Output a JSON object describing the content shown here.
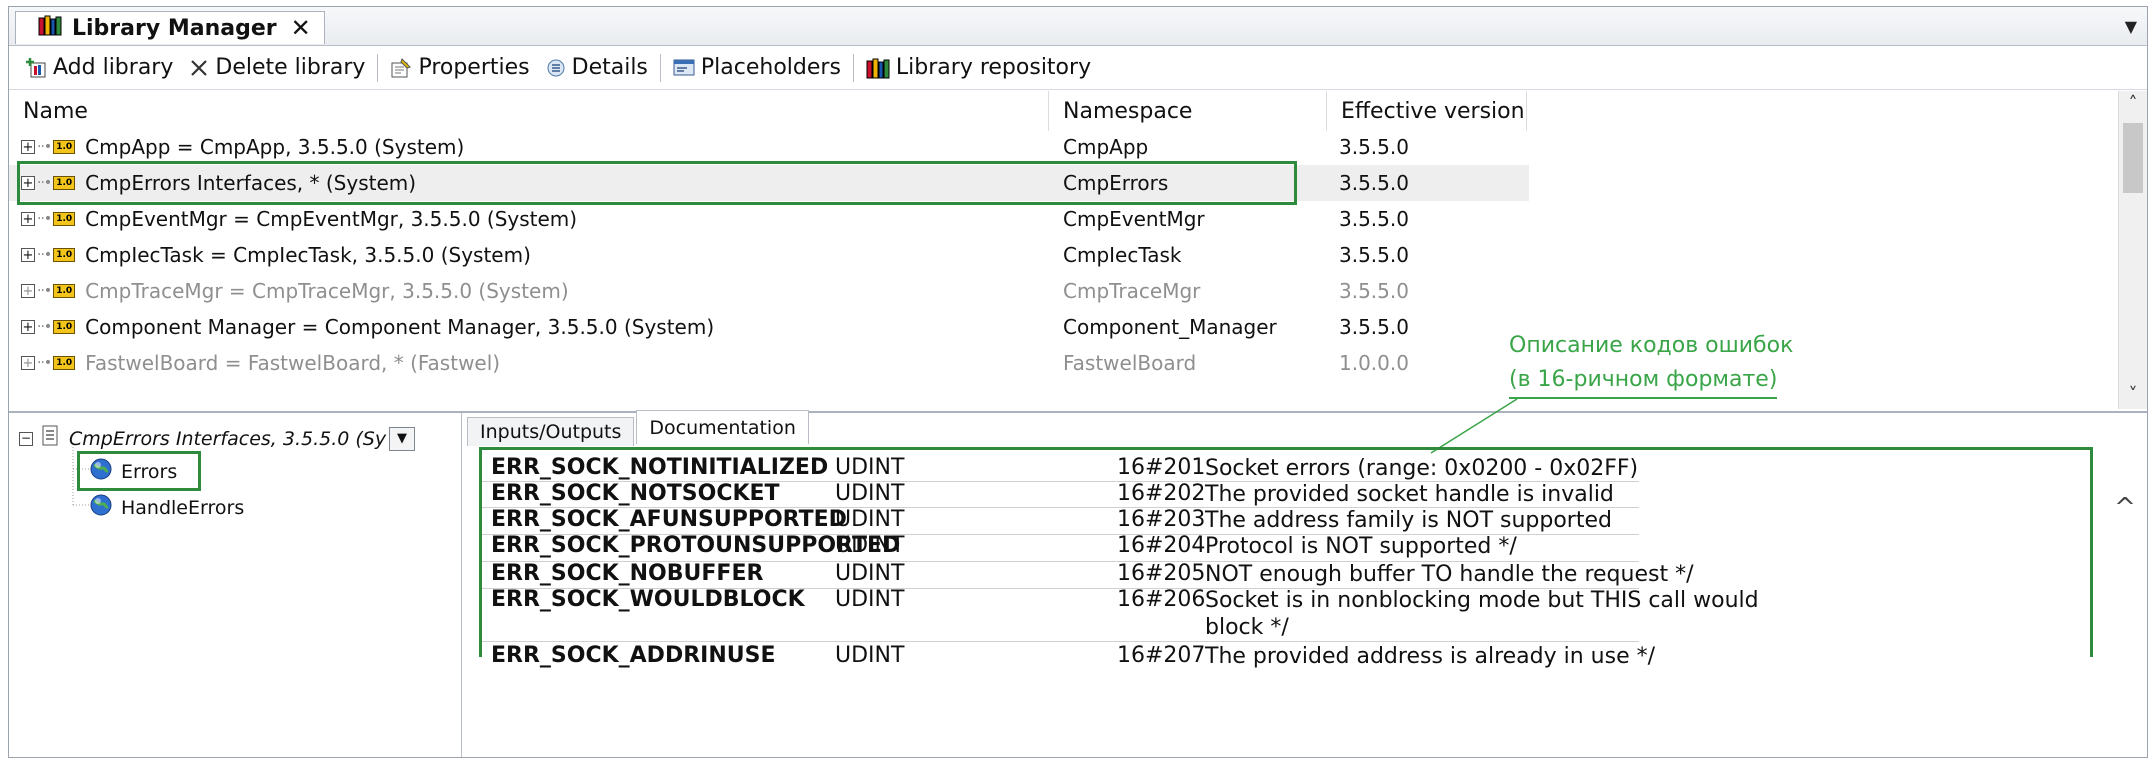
{
  "tab": {
    "title": "Library Manager",
    "close": "✕",
    "menu": "▼"
  },
  "toolbar": {
    "add_library": "Add library",
    "delete_library": "Delete library",
    "properties": "Properties",
    "details": "Details",
    "placeholders": "Placeholders",
    "library_repository": "Library repository"
  },
  "list": {
    "headers": {
      "name": "Name",
      "namespace": "Namespace",
      "version": "Effective version"
    },
    "rows": [
      {
        "name": "CmpApp = CmpApp, 3.5.5.0 (System)",
        "namespace": "CmpApp",
        "version": "3.5.5.0",
        "state": "normal"
      },
      {
        "name": "CmpErrors Interfaces, * (System)",
        "namespace": "CmpErrors",
        "version": "3.5.5.0",
        "state": "selected"
      },
      {
        "name": "CmpEventMgr = CmpEventMgr, 3.5.5.0 (System)",
        "namespace": "CmpEventMgr",
        "version": "3.5.5.0",
        "state": "normal"
      },
      {
        "name": "CmpIecTask = CmpIecTask, 3.5.5.0 (System)",
        "namespace": "CmpIecTask",
        "version": "3.5.5.0",
        "state": "normal"
      },
      {
        "name": "CmpTraceMgr = CmpTraceMgr, 3.5.5.0 (System)",
        "namespace": "CmpTraceMgr",
        "version": "3.5.5.0",
        "state": "disabled"
      },
      {
        "name": "Component Manager = Component Manager, 3.5.5.0 (System)",
        "namespace": "Component_Manager",
        "version": "3.5.5.0",
        "state": "normal"
      },
      {
        "name": "FastwelBoard = FastwelBoard, * (Fastwel)",
        "namespace": "FastwelBoard",
        "version": "1.0.0.0",
        "state": "disabled"
      }
    ],
    "badge": "1.0",
    "scroll_up": "˄",
    "scroll_down": "˅"
  },
  "annotation": {
    "line1": "Описание кодов ошибок",
    "line2": "(в 16-ричном формате)"
  },
  "tree": {
    "root": "CmpErrors Interfaces, 3.5.5.0 (Sy",
    "combo_arrow": "▼",
    "items": [
      "Errors",
      "HandleErrors"
    ]
  },
  "doc": {
    "tabs": [
      "Inputs/Outputs",
      "Documentation"
    ],
    "active_tab": "Documentation",
    "rows": [
      {
        "name": "ERR_SOCK_NOTINITIALIZED",
        "type": "UDINT",
        "value": "16#201",
        "desc": "Socket errors (range: 0x0200 - 0x02FF)"
      },
      {
        "name": "ERR_SOCK_NOTSOCKET",
        "type": "UDINT",
        "value": "16#202",
        "desc": "The provided socket handle is invalid"
      },
      {
        "name": "ERR_SOCK_AFUNSUPPORTED",
        "type": "UDINT",
        "value": "16#203",
        "desc": "The address family is NOT supported"
      },
      {
        "name": "ERR_SOCK_PROTOUNSUPPORTED",
        "type": "UDINT",
        "value": "16#204",
        "desc": "Protocol is NOT supported */"
      },
      {
        "name": "ERR_SOCK_NOBUFFER",
        "type": "UDINT",
        "value": "16#205",
        "desc": "NOT enough buffer TO handle the request */"
      },
      {
        "name": "ERR_SOCK_WOULDBLOCK",
        "type": "UDINT",
        "value": "16#206",
        "desc": "Socket is in nonblocking mode but THIS call would block */"
      },
      {
        "name": "ERR_SOCK_ADDRINUSE",
        "type": "UDINT",
        "value": "16#207",
        "desc": "The provided address is already in use */"
      }
    ],
    "scroll_up": "^"
  },
  "colors": {
    "highlight": "#2e8b3d",
    "annotation": "#3aa548",
    "badge": "#f3c41a"
  },
  "icons": [
    "library-icon",
    "add-library-icon",
    "delete-icon",
    "properties-icon",
    "details-icon",
    "placeholders-icon",
    "library-repository-icon",
    "globe-icon",
    "document-icon"
  ]
}
